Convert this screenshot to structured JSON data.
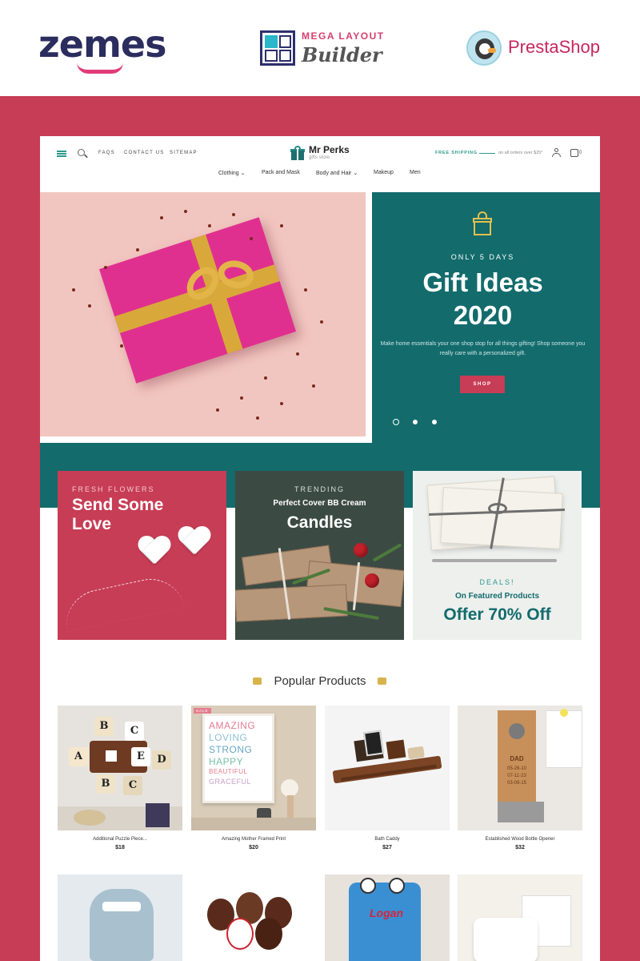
{
  "brands": {
    "zemes": "zemes",
    "builder_top": "MEGA LAYOUT",
    "builder_bottom": "Builder",
    "prestashop": "PrestaShop"
  },
  "header": {
    "links": [
      "FAQS",
      "CONTACT US",
      "SITEMAP"
    ],
    "store_name": "Mr Perks",
    "store_tagline": "gifts store",
    "shipping_label": "FREE SHIPPING",
    "shipping_note": "on all orders over $25*",
    "cart_count": "0",
    "nav": [
      "Clothing",
      "Pack and Mask",
      "Body and Hair",
      "Makeup",
      "Men"
    ]
  },
  "hero": {
    "eyebrow": "ONLY 5 DAYS",
    "title_line1": "Gift Ideas",
    "title_line2": "2020",
    "description": "Make home essentials your one shop stop for all things gifting! Shop someone you really care with a personalized gift.",
    "button": "SHOP",
    "slides": 3,
    "active_slide": 1
  },
  "promos": [
    {
      "eyebrow": "FRESH FLOWERS",
      "line1": "Send Some",
      "line2": "Love"
    },
    {
      "eyebrow": "TRENDING",
      "subtitle": "Perfect Cover BB Cream",
      "title": "Candles"
    },
    {
      "eyebrow": "DEALS!",
      "subtitle": "On Featured Products",
      "title": "Offer 70% Off"
    }
  ],
  "popular": {
    "title": "Popular Products",
    "products": [
      {
        "name": "Additional Puzzle Piece...",
        "price": "$18",
        "badge": ""
      },
      {
        "name": "Amazing Mother Framed Print",
        "price": "$20",
        "badge": "SALE"
      },
      {
        "name": "Bath Caddy",
        "price": "$27",
        "badge": ""
      },
      {
        "name": "Established Wood Bottle Opener",
        "price": "$32",
        "badge": ""
      }
    ],
    "frame_words": [
      "AMAZING",
      "LOVING",
      "STRONG",
      "HAPPY",
      "BEAUTIFUL",
      "GRACEFUL"
    ],
    "puzzle_letters": [
      "B",
      "C",
      "A",
      "E",
      "D",
      "B",
      "C"
    ],
    "opener_text": [
      "DAD",
      "05-26-10",
      "07-11-23",
      "03-09-15"
    ],
    "row2_name_text": "Logan"
  },
  "colors": {
    "brand_red": "#c73d55",
    "teal": "#136b6c",
    "accent_teal": "#2a9a8c"
  }
}
